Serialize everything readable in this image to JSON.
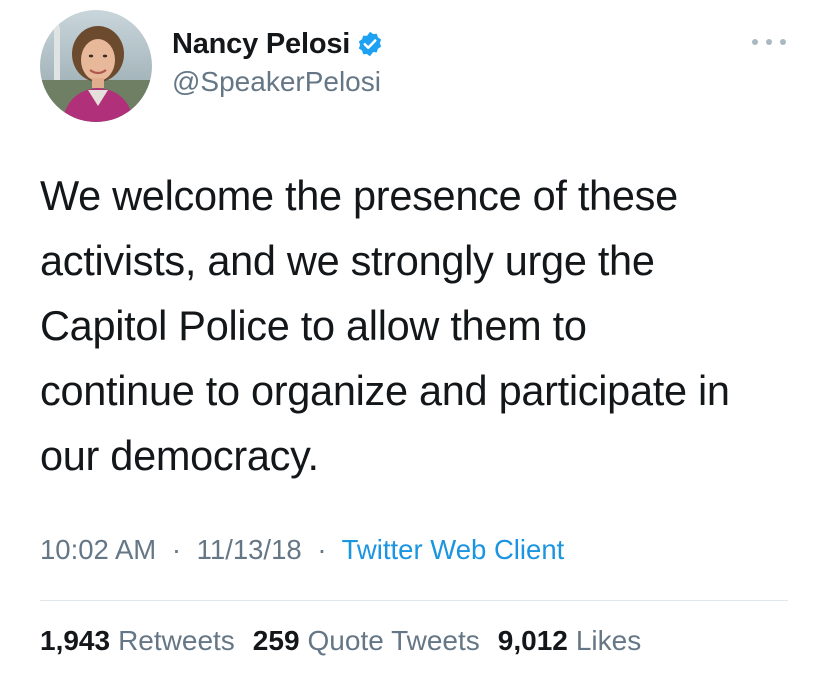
{
  "author": {
    "display_name": "Nancy Pelosi",
    "handle": "@SpeakerPelosi",
    "verified": true
  },
  "tweet": {
    "lines": [
      "We welcome the presence of these",
      "activists, and we strongly urge the",
      "Capitol Police to allow them to",
      "continue to organize and participate in",
      "our democracy."
    ]
  },
  "meta": {
    "time": "10:02 AM",
    "separator": "·",
    "date": "11/13/18",
    "client": "Twitter Web Client"
  },
  "stats": {
    "retweets_count": "1,943",
    "retweets_label": "Retweets",
    "quotes_count": "259",
    "quotes_label": "Quote Tweets",
    "likes_count": "9,012",
    "likes_label": "Likes"
  },
  "colors": {
    "text": "#14171a",
    "secondary": "#657786",
    "link": "#1b95e0",
    "verified": "#1da1f2"
  },
  "icons": {
    "verified": "verified-badge-icon",
    "more": "more-options-icon"
  }
}
